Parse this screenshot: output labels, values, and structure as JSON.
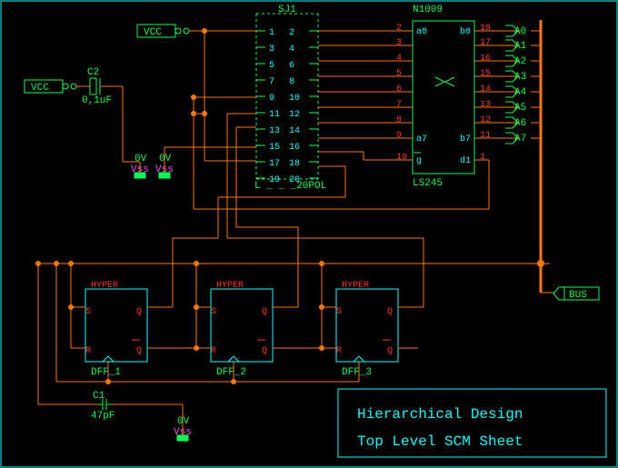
{
  "titleBox": {
    "line1": "Hierarchical Design",
    "line2": "Top Level SCM Sheet"
  },
  "vcc1": "VCC",
  "vcc2": "VCC",
  "c1": {
    "ref": "C1",
    "val": "47pF"
  },
  "c2": {
    "ref": "C2",
    "val": "0,1uF"
  },
  "vss": [
    {
      "v": "0V",
      "name": "Vss"
    },
    {
      "v": "0V",
      "name": "Vss"
    },
    {
      "v": "0V",
      "name": "Vss"
    }
  ],
  "dffs": [
    {
      "title": "HYPER",
      "name": "DFF_1",
      "s": "S",
      "r": "R",
      "q": "Q",
      "qb": "Q"
    },
    {
      "title": "HYPER",
      "name": "DFF_2",
      "s": "S",
      "r": "R",
      "q": "Q",
      "qb": "Q"
    },
    {
      "title": "HYPER",
      "name": "DFF_3",
      "s": "S",
      "r": "R",
      "q": "Q",
      "qb": "Q"
    }
  ],
  "busLabel": "BUS",
  "header": {
    "ref": "SJ1",
    "footprint": "L _ _ _20POL",
    "leftPins": [
      "1",
      "3",
      "5",
      "7",
      "9",
      "11",
      "13",
      "15",
      "17",
      "19"
    ],
    "rightPins": [
      "2",
      "4",
      "6",
      "8",
      "10",
      "12",
      "14",
      "16",
      "18",
      "20"
    ]
  },
  "ic": {
    "ref": "N1009",
    "name": "LS245",
    "leftPins": [
      "2",
      "3",
      "4",
      "5",
      "6",
      "7",
      "8",
      "9",
      "19"
    ],
    "leftLabels": [
      "a0",
      "",
      "",
      "",
      "",
      "",
      "",
      "a7",
      "g"
    ],
    "rightPins": [
      "18",
      "17",
      "16",
      "15",
      "14",
      "13",
      "12",
      "11",
      "1"
    ],
    "rightLabels": [
      "b0",
      "",
      "",
      "",
      "",
      "",
      "",
      "b7",
      "d1"
    ]
  },
  "aLabels": [
    "A0",
    "A1",
    "A2",
    "A3",
    "A4",
    "A5",
    "A6",
    "A7"
  ]
}
